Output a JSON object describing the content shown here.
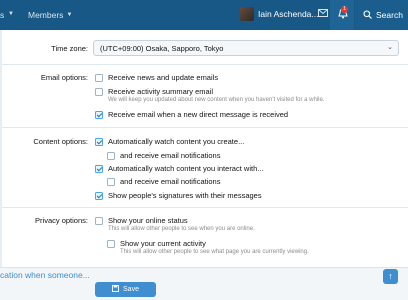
{
  "nav": {
    "prev_item": "s",
    "members_label": "Members",
    "username": "Iain Aschenda...",
    "alert_count": "1",
    "search_label": "Search"
  },
  "timezone": {
    "label": "Time zone:",
    "value": "(UTC+09:00) Osaka, Sapporo, Tokyo"
  },
  "email_options": {
    "label": "Email options:",
    "items": [
      {
        "text": "Receive news and update emails",
        "checked": false,
        "hint": ""
      },
      {
        "text": "Receive activity summary email",
        "checked": false,
        "hint": "We will keep you updated about new content when you haven't visited for a while."
      },
      {
        "text": "Receive email when a new direct message is received",
        "checked": true,
        "hint": ""
      }
    ]
  },
  "content_options": {
    "label": "Content options:",
    "items": [
      {
        "text": "Automatically watch content you create...",
        "checked": true
      },
      {
        "text": "and receive email notifications",
        "checked": false
      },
      {
        "text": "Automatically watch content you interact with...",
        "checked": true
      },
      {
        "text": "and receive email notifications",
        "checked": false
      },
      {
        "text": "Show people's signatures with their messages",
        "checked": true
      }
    ]
  },
  "privacy_options": {
    "label": "Privacy options:",
    "items": [
      {
        "text": "Show your online status",
        "checked": false,
        "hint": "This will allow other people to see when you are online."
      },
      {
        "text": "Show your current activity",
        "checked": false,
        "hint": "This will allow other people to see what page you are currently viewing."
      }
    ]
  },
  "footer": {
    "notification_text": "cation when someone...",
    "save_label": "Save"
  },
  "colors": {
    "nav_bg": "#185886",
    "accent": "#3e8ed0",
    "badge": "#e03c31"
  }
}
